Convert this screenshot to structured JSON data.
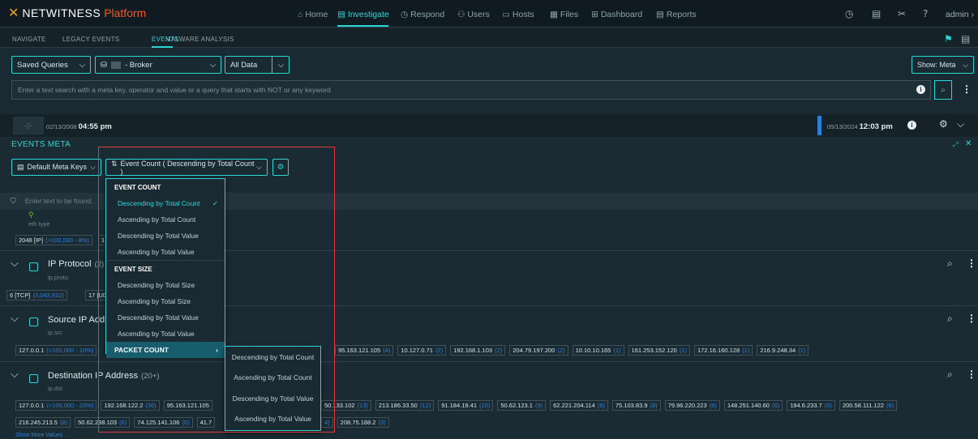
{
  "brand": {
    "mark": "✕",
    "name": "NETWITNESS",
    "suffix": "Platform"
  },
  "nav": [
    {
      "icon": "⌂",
      "label": "Home"
    },
    {
      "icon": "▤",
      "label": "Investigate",
      "active": true
    },
    {
      "icon": "◷",
      "label": "Respond"
    },
    {
      "icon": "⚇",
      "label": "Users"
    },
    {
      "icon": "▭",
      "label": "Hosts"
    },
    {
      "icon": "▦",
      "label": "Files"
    },
    {
      "icon": "⊞",
      "label": "Dashboard"
    },
    {
      "icon": "▤",
      "label": "Reports"
    }
  ],
  "user": {
    "label": "admin ›"
  },
  "subnav": {
    "tabs": [
      "NAVIGATE",
      "LEGACY EVENTS",
      "EVENTS",
      "MALWARE ANALYSIS"
    ],
    "active": "EVENTS"
  },
  "query": {
    "saved_queries": "Saved Queries",
    "service": "- Broker",
    "data_scope": "All Data",
    "show_meta": "Show: Meta",
    "search_placeholder": "Enter a text search with a meta key, operator and value or a query that starts with NOT or any keyword"
  },
  "timeline": {
    "start_date": "02/13/2008",
    "start_time": "04:55 pm",
    "end_date": "05/13/2024",
    "end_time": "12:03 pm"
  },
  "events_meta": {
    "title": "EVENTS META",
    "meta_keys": "Default Meta Keys",
    "sort": "Event Count ( Descending by Total Count )",
    "filter_placeholder": "Enter text to be found."
  },
  "sections": [
    {
      "title": "",
      "count": "",
      "key": "eth.type",
      "chips": [
        {
          "v": "2048 [IP]",
          "c": "(>100,000 - 8%)"
        },
        {
          "v": "1",
          "c": ""
        }
      ]
    },
    {
      "title": "IP Protocol",
      "count": "(2)",
      "key": "ip.proto",
      "chips": [
        {
          "v": "6 [TCP]",
          "c": "(3,043,922)"
        },
        {
          "v": "17 [UD",
          "c": ""
        }
      ]
    },
    {
      "title": "Source IP Addre",
      "count": "",
      "key": "ip.src",
      "chips": [
        {
          "v": "127.0.0.1",
          "c": "(>100,000 - 10%)"
        },
        {
          "v": "95.163.121.105",
          "c": "(4)"
        },
        {
          "v": "10.127.0.71",
          "c": "(2)"
        },
        {
          "v": "192.168.1.103",
          "c": "(2)"
        },
        {
          "v": "204.79.197.200",
          "c": "(2)"
        },
        {
          "v": "10.10.10.165",
          "c": "(1)"
        },
        {
          "v": "161.253.152.120",
          "c": "(1)"
        },
        {
          "v": "172.16.160.128",
          "c": "(1)"
        },
        {
          "v": "216.9.248.34",
          "c": "(1)"
        }
      ]
    },
    {
      "title": "Destination IP Address",
      "count": "(20+)",
      "key": "ip.dst",
      "row1": [
        {
          "v": "127.0.0.1",
          "c": "(>100,000 - 20%)"
        },
        {
          "v": "192.168.122.2",
          "c": "(36)"
        },
        {
          "v": "95.163.121.105",
          "c": ""
        },
        {
          "v": "50.133.102",
          "c": "(13)"
        },
        {
          "v": "213.186.33.50",
          "c": "(12)"
        },
        {
          "v": "91.184.19.41",
          "c": "(10)"
        },
        {
          "v": "50.62.123.1",
          "c": "(9)"
        },
        {
          "v": "62.221.204.114",
          "c": "(8)"
        },
        {
          "v": "75.103.83.9",
          "c": "(8)"
        },
        {
          "v": "79.96.220.223",
          "c": "(8)"
        },
        {
          "v": "148.251.140.60",
          "c": "(6)"
        },
        {
          "v": "194.6.233.7",
          "c": "(6)"
        },
        {
          "v": "200.58.111.122",
          "c": "(6)"
        }
      ],
      "row2": [
        {
          "v": "216.245.213.5",
          "c": "(8)"
        },
        {
          "v": "50.62.238.103",
          "c": "(6)"
        },
        {
          "v": "74.125.141.106",
          "c": "(6)"
        },
        {
          "v": "41.7",
          "c": ""
        },
        {
          "v": "4)",
          "c": ""
        },
        {
          "v": "208.75.188.2",
          "c": "(3)"
        }
      ],
      "more": "Show More Values"
    }
  ],
  "dropdown": {
    "event_count_header": "EVENT COUNT",
    "event_count": [
      "Descending by Total Count",
      "Ascending by Total Count",
      "Descending by Total Value",
      "Ascending by Total Value"
    ],
    "event_size_header": "EVENT SIZE",
    "event_size": [
      "Descending by Total Size",
      "Ascending by Total Size",
      "Descending by Total Value",
      "Ascending by Total Value"
    ],
    "packet_count_header": "PACKET COUNT",
    "checkmark": "✓",
    "packet_count": [
      "Descending by Total Count",
      "Ascending by Total Count",
      "Descending by Total Value",
      "Ascending by Total Value"
    ]
  },
  "colors": {
    "accent": "#2dd6d6",
    "highlight": "#175d6e",
    "annotation": "#e03a3a",
    "count": "#2f7fd6"
  }
}
